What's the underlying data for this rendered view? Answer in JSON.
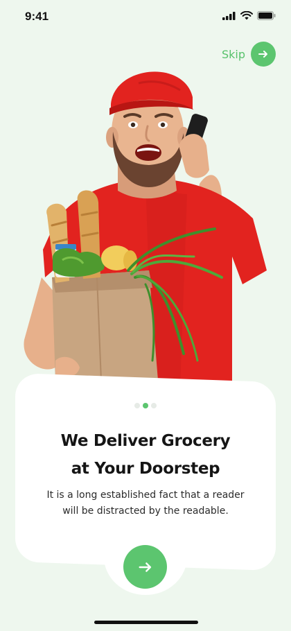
{
  "status_bar": {
    "time": "9:41"
  },
  "skip": {
    "label": "Skip"
  },
  "onboarding": {
    "title_line1": "We Deliver Grocery",
    "title_line2": "at Your Doorstep",
    "description_line1": "It is a long established fact that a reader",
    "description_line2": "will be distracted by the readable.",
    "pagination": {
      "total": 3,
      "current": 2
    }
  },
  "icons": {
    "skip": "arrow-right-icon",
    "next": "arrow-right-icon",
    "signal": "cellular-signal-icon",
    "wifi": "wifi-icon",
    "battery": "battery-icon"
  },
  "colors": {
    "background": "#eef7ee",
    "accent": "#5cc56f",
    "card": "#ffffff",
    "title": "#151515"
  }
}
